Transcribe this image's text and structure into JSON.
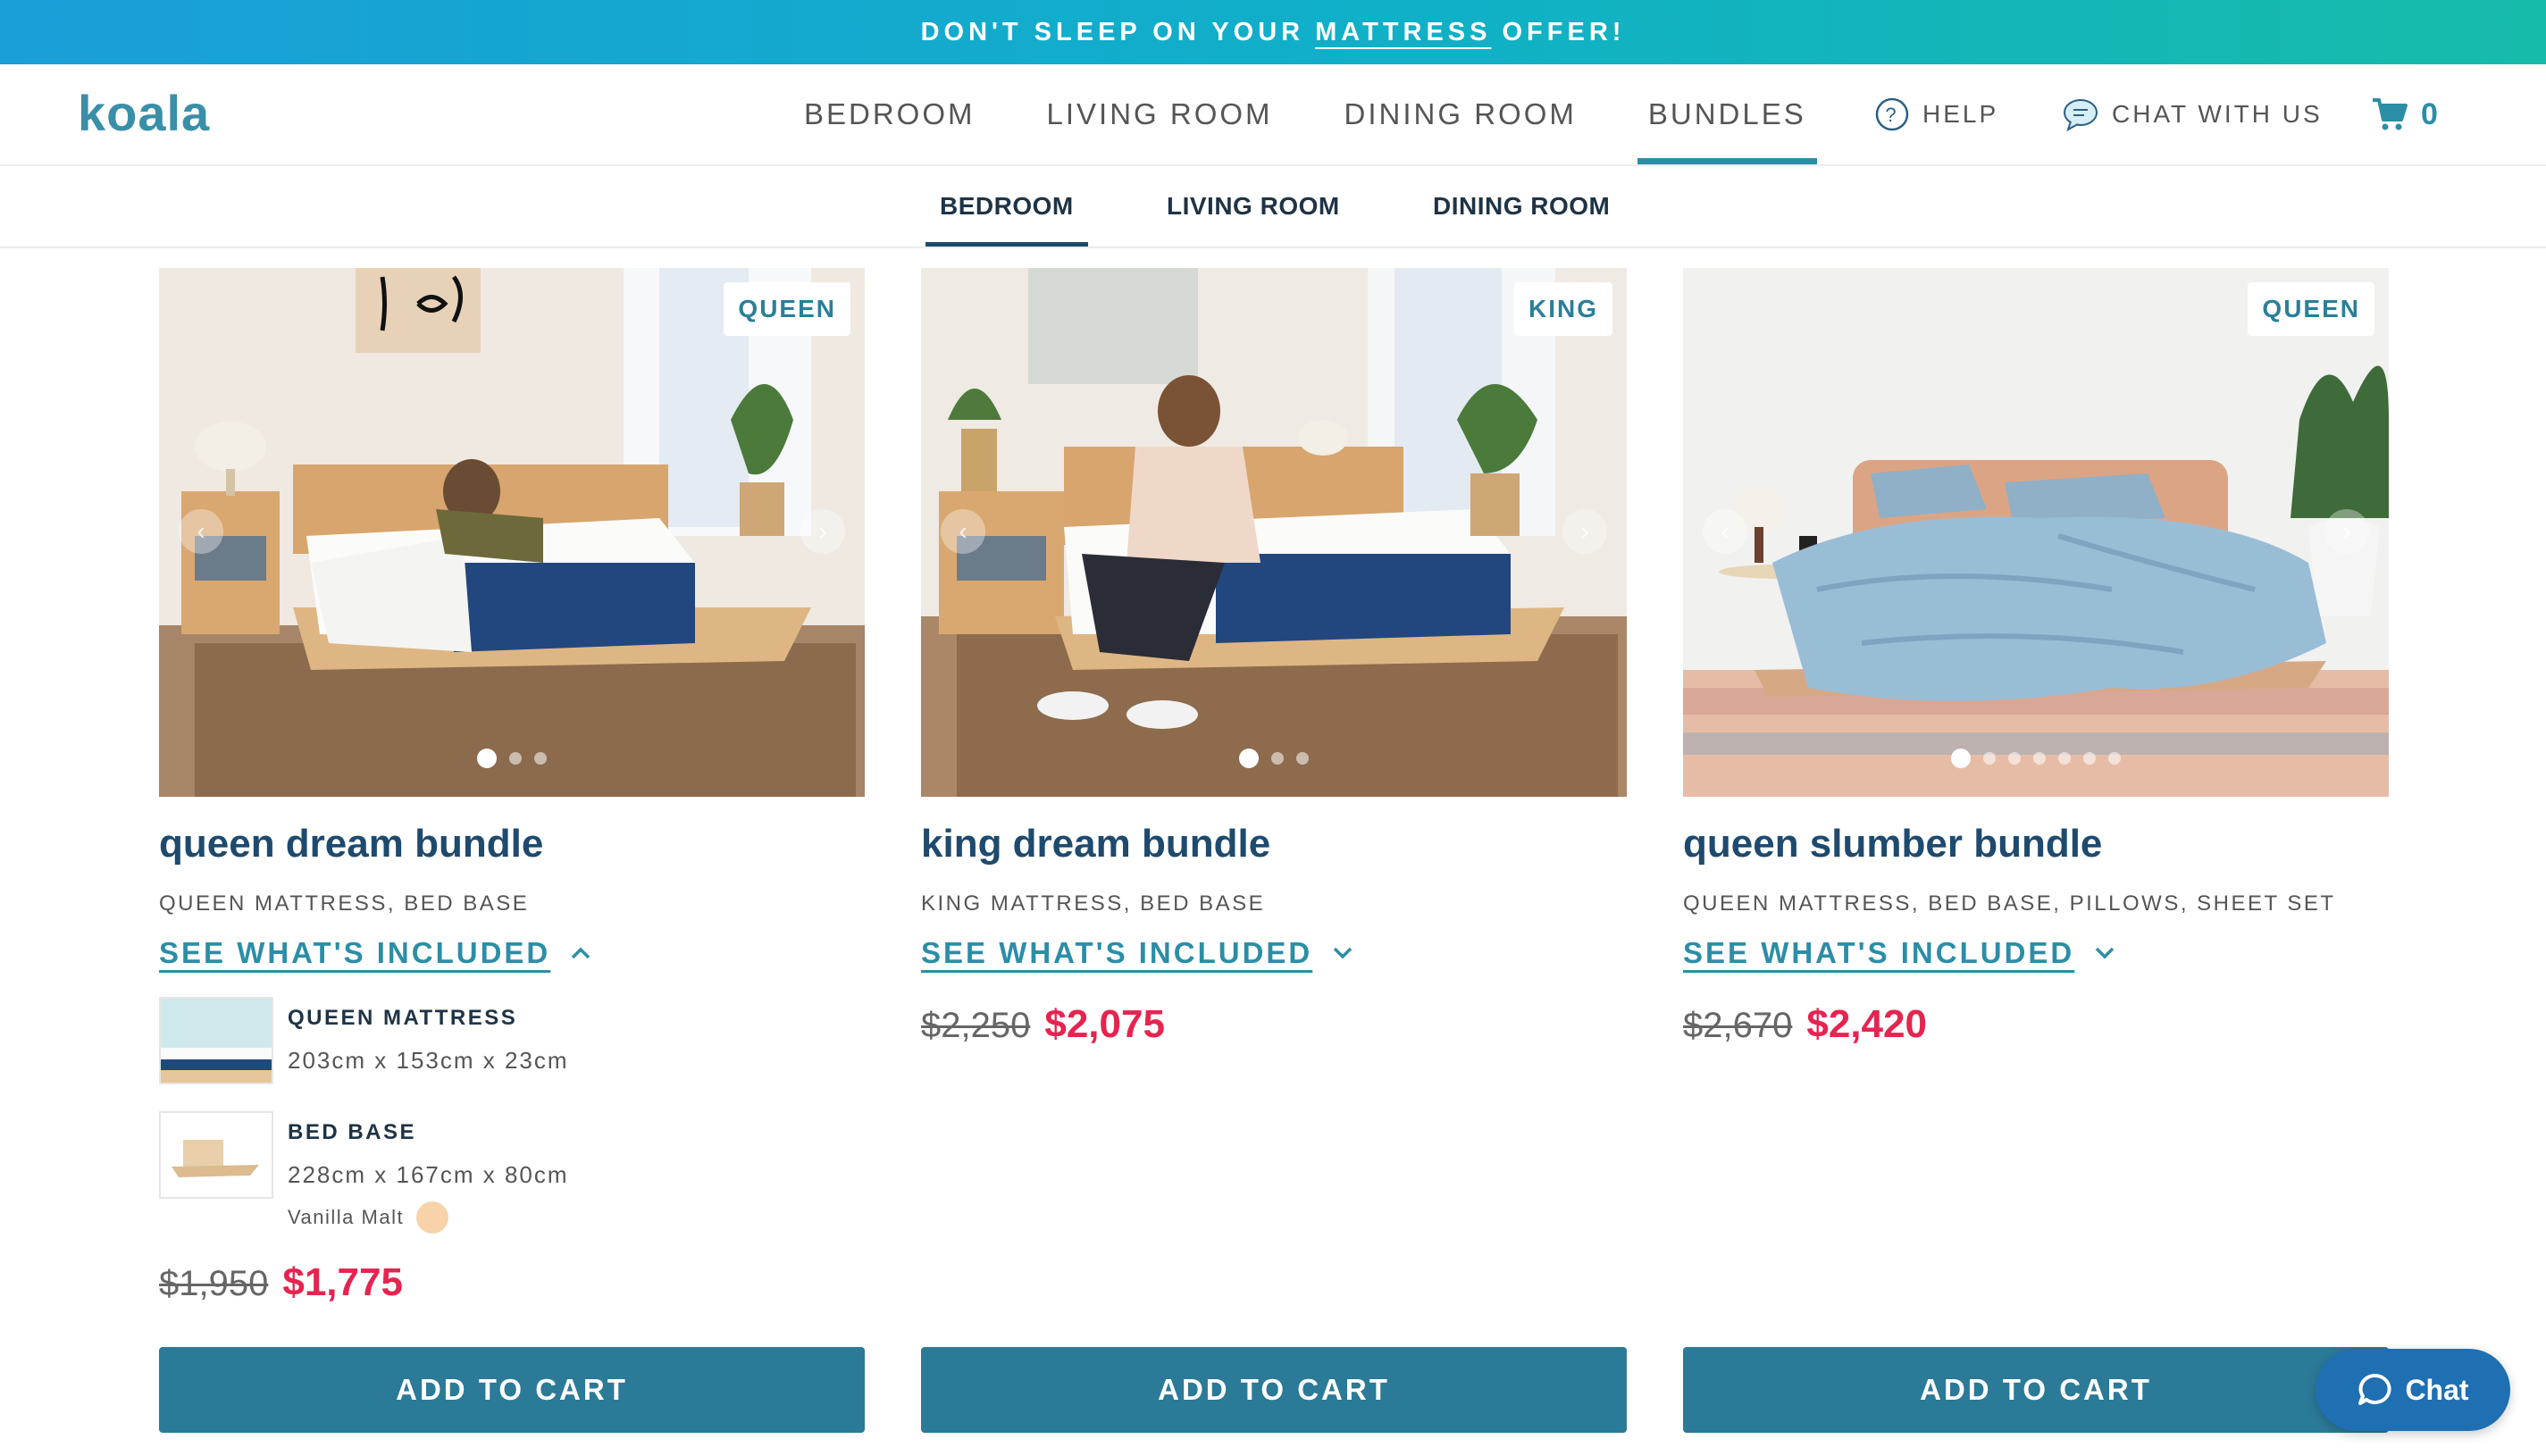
{
  "promo": {
    "before": "DON'T SLEEP ON YOUR",
    "link": "MATTRESS",
    "after": "OFFER!"
  },
  "logo": "koala",
  "nav": {
    "items": [
      "BEDROOM",
      "LIVING ROOM",
      "DINING ROOM",
      "BUNDLES"
    ],
    "active": "BUNDLES",
    "help": "HELP",
    "chat": "CHAT WITH US",
    "cart_count": "0"
  },
  "subnav": {
    "items": [
      "BEDROOM",
      "LIVING ROOM",
      "DINING ROOM"
    ],
    "active": "BEDROOM"
  },
  "colors": {
    "accent": "#2b8ea6",
    "title": "#1e4a6e",
    "sale": "#e5244f",
    "button": "#2b7a98"
  },
  "products": [
    {
      "badge": "QUEEN",
      "title": "queen dream bundle",
      "subtitle": "QUEEN MATTRESS, BED BASE",
      "included_label": "SEE WHAT'S INCLUDED",
      "expanded": true,
      "items": [
        {
          "name": "QUEEN MATTRESS",
          "dims": "203cm x 153cm x 23cm"
        },
        {
          "name": "BED BASE",
          "dims": "228cm x 167cm x 80cm",
          "color": "Vanilla Malt"
        }
      ],
      "old_price": "$1,950",
      "price": "$1,775",
      "cta": "ADD TO CART",
      "image_count": 3
    },
    {
      "badge": "KING",
      "title": "king dream bundle",
      "subtitle": "KING MATTRESS, BED BASE",
      "included_label": "SEE WHAT'S INCLUDED",
      "expanded": false,
      "old_price": "$2,250",
      "price": "$2,075",
      "cta": "ADD TO CART",
      "image_count": 3
    },
    {
      "badge": "QUEEN",
      "title": "queen slumber bundle",
      "subtitle": "QUEEN MATTRESS, BED BASE, PILLOWS, SHEET SET",
      "included_label": "SEE WHAT'S INCLUDED",
      "expanded": false,
      "old_price": "$2,670",
      "price": "$2,420",
      "cta": "ADD TO CART",
      "image_count": 7
    }
  ],
  "chat_widget": "Chat"
}
